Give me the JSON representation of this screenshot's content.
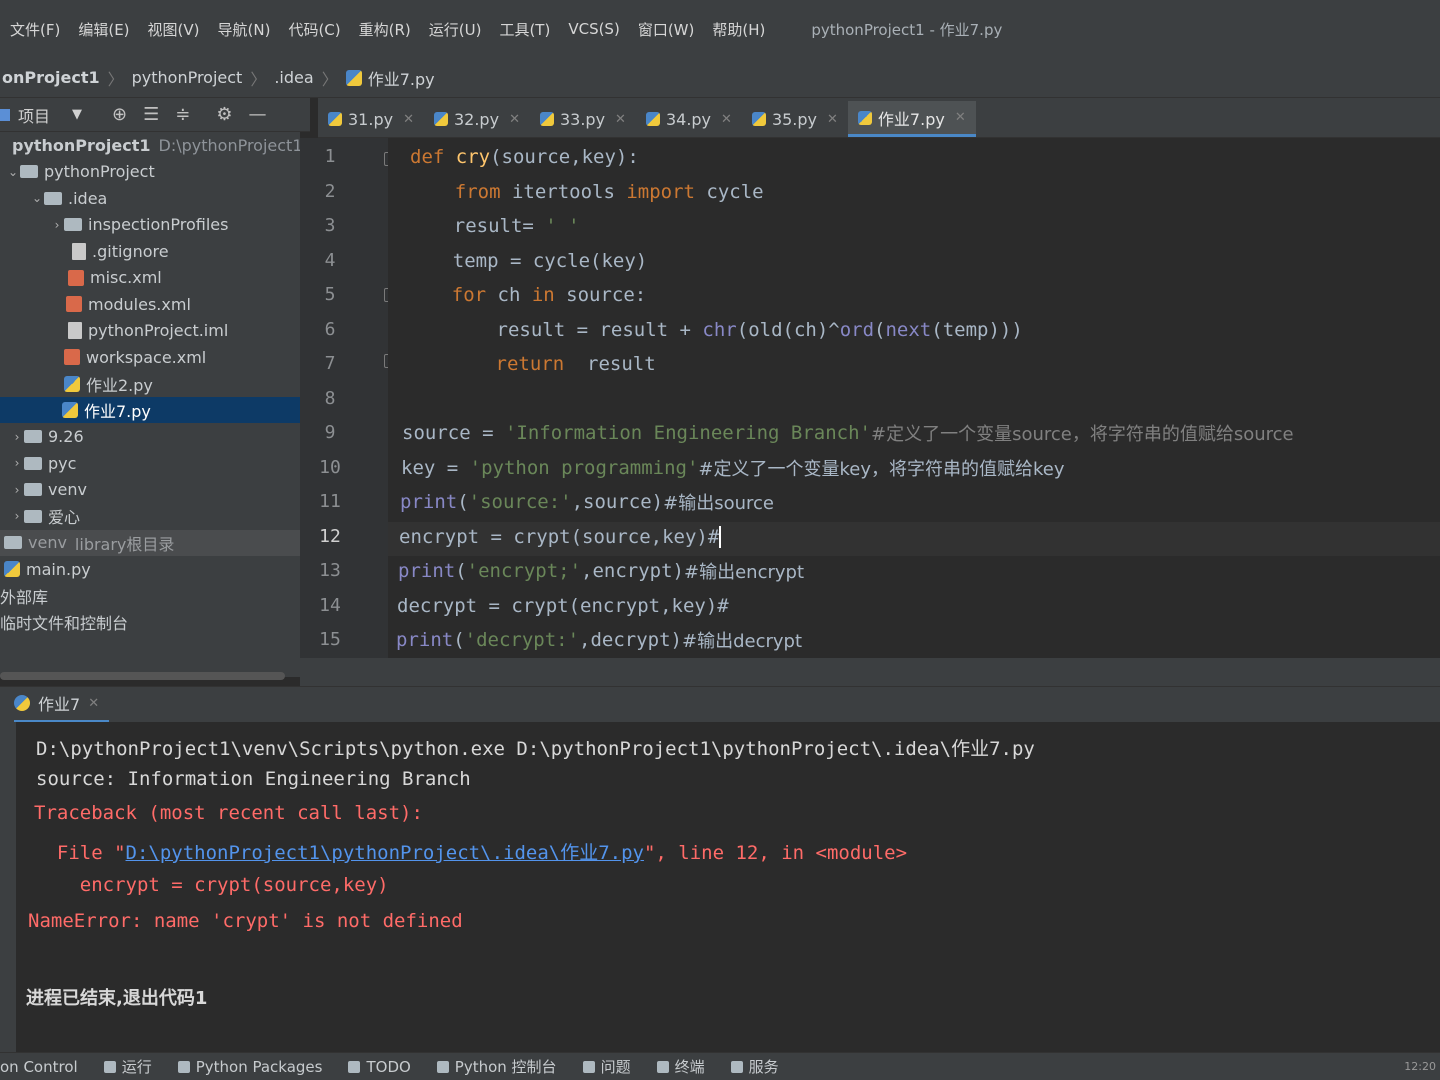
{
  "menu": {
    "items": [
      "文件(F)",
      "编辑(E)",
      "视图(V)",
      "导航(N)",
      "代码(C)",
      "重构(R)",
      "运行(U)",
      "工具(T)",
      "VCS(S)",
      "窗口(W)",
      "帮助(H)"
    ],
    "window_title": "pythonProject1 - 作业7.py"
  },
  "breadcrumb": [
    "onProject1",
    "pythonProject",
    ".idea",
    "作业7.py"
  ],
  "project_panel": {
    "title": "项目",
    "tree": [
      {
        "label": "pythonProject1",
        "path": "D:\\pythonProject1",
        "kind": "folder",
        "expanded": true
      },
      {
        "label": "pythonProject",
        "kind": "folder",
        "expanded": true
      },
      {
        "label": ".idea",
        "kind": "folder",
        "expanded": true
      },
      {
        "label": "inspectionProfiles",
        "kind": "folder",
        "expanded": false
      },
      {
        "label": ".gitignore",
        "kind": "file"
      },
      {
        "label": "misc.xml",
        "kind": "xml"
      },
      {
        "label": "modules.xml",
        "kind": "xml"
      },
      {
        "label": "pythonProject.iml",
        "kind": "file"
      },
      {
        "label": "workspace.xml",
        "kind": "xml"
      },
      {
        "label": "作业2.py",
        "kind": "py"
      },
      {
        "label": "作业7.py",
        "kind": "py",
        "selected": true
      },
      {
        "label": "9.26",
        "kind": "folder",
        "expanded": false
      },
      {
        "label": "pyc",
        "kind": "folder",
        "expanded": false
      },
      {
        "label": "venv",
        "kind": "folder",
        "expanded": false
      },
      {
        "label": "爱心",
        "kind": "folder",
        "expanded": false
      },
      {
        "label": "venv",
        "suffix": "library根目录",
        "kind": "folder",
        "library": true
      },
      {
        "label": "main.py",
        "kind": "py"
      },
      {
        "label": "外部库",
        "kind": "text"
      },
      {
        "label": "临时文件和控制台",
        "kind": "text"
      }
    ]
  },
  "tabs": [
    {
      "label": "31.py",
      "active": false
    },
    {
      "label": "32.py",
      "active": false
    },
    {
      "label": "33.py",
      "active": false
    },
    {
      "label": "34.py",
      "active": false
    },
    {
      "label": "35.py",
      "active": false
    },
    {
      "label": "作业7.py",
      "active": true
    }
  ],
  "editor": {
    "current_line": 12,
    "line_numbers": [
      "1",
      "2",
      "3",
      "4",
      "5",
      "6",
      "7",
      "8",
      "9",
      "10",
      "11",
      "12",
      "13",
      "14",
      "15"
    ],
    "lines": [
      [
        {
          "t": "def ",
          "c": "kw"
        },
        {
          "t": "cry",
          "c": "fn"
        },
        {
          "t": "(source,key):",
          "c": "pl"
        }
      ],
      [
        {
          "t": "    from ",
          "c": "kw"
        },
        {
          "t": "itertools ",
          "c": "pl"
        },
        {
          "t": "import ",
          "c": "kw"
        },
        {
          "t": "cycle",
          "c": "pl"
        }
      ],
      [
        {
          "t": "    result= ",
          "c": "pl"
        },
        {
          "t": "' '",
          "c": "st"
        }
      ],
      [
        {
          "t": "    temp = cycle(key)",
          "c": "pl"
        }
      ],
      [
        {
          "t": "    for ",
          "c": "kw"
        },
        {
          "t": "ch ",
          "c": "pl"
        },
        {
          "t": "in ",
          "c": "kw"
        },
        {
          "t": "source:",
          "c": "pl"
        }
      ],
      [
        {
          "t": "        result = result + ",
          "c": "pl"
        },
        {
          "t": "chr",
          "c": "bi"
        },
        {
          "t": "(old(ch)^",
          "c": "pl"
        },
        {
          "t": "ord",
          "c": "bi"
        },
        {
          "t": "(",
          "c": "pl"
        },
        {
          "t": "next",
          "c": "bi"
        },
        {
          "t": "(temp)))",
          "c": "pl"
        }
      ],
      [
        {
          "t": "        return  ",
          "c": "kw"
        },
        {
          "t": "result",
          "c": "pl"
        }
      ],
      [],
      [
        {
          "t": "source = ",
          "c": "pl"
        },
        {
          "t": "'Information Engineering Branch'",
          "c": "st"
        },
        {
          "t": "#定义了一个变量source，将字符串的值赋给source",
          "c": "cmd"
        }
      ],
      [
        {
          "t": "key = ",
          "c": "pl"
        },
        {
          "t": "'python programming'",
          "c": "st"
        },
        {
          "t": "#定义了一个变量key，将字符串的值赋给key",
          "c": "cm"
        }
      ],
      [
        {
          "t": "print",
          "c": "bi"
        },
        {
          "t": "(",
          "c": "pl"
        },
        {
          "t": "'source:'",
          "c": "st"
        },
        {
          "t": ",source)",
          "c": "pl"
        },
        {
          "t": "#输出source",
          "c": "cm"
        }
      ],
      [
        {
          "t": "encrypt = crypt(source,key)#",
          "c": "pl"
        }
      ],
      [
        {
          "t": "print",
          "c": "bi"
        },
        {
          "t": "(",
          "c": "pl"
        },
        {
          "t": "'encrypt;'",
          "c": "st"
        },
        {
          "t": ",encrypt)",
          "c": "pl"
        },
        {
          "t": "#输出encrypt",
          "c": "cm"
        }
      ],
      [
        {
          "t": "decrypt = crypt(encrypt,key)#",
          "c": "pl"
        }
      ],
      [
        {
          "t": "print",
          "c": "bi"
        },
        {
          "t": "(",
          "c": "pl"
        },
        {
          "t": "'decrypt:'",
          "c": "st"
        },
        {
          "t": ",decrypt)",
          "c": "pl"
        },
        {
          "t": "#输出decrypt",
          "c": "cm"
        }
      ]
    ]
  },
  "run": {
    "tab_label": "作业7",
    "command": "D:\\pythonProject1\\venv\\Scripts\\python.exe D:\\pythonProject1\\pythonProject\\.idea\\作业7.py",
    "output_source": "source: Information Engineering Branch",
    "traceback_header": "Traceback (most recent call last):",
    "file_prefix": "  File \"",
    "file_link": "D:\\pythonProject1\\pythonProject\\.idea\\作业7.py",
    "file_suffix": "\", line 12, in <module>",
    "code_line": "    encrypt = crypt(source,key)",
    "error": "NameError: name 'crypt' is not defined",
    "exit_message": "进程已结束,退出代码1"
  },
  "bottom_toolbar": [
    "on Control",
    "运行",
    "Python Packages",
    "TODO",
    "Python 控制台",
    "问题",
    "终端",
    "服务"
  ],
  "clock": "12:20",
  "colors": {
    "keyword": "#cc7832",
    "string": "#6a8759",
    "error": "#ff6b68",
    "link": "#5394ec",
    "selection": "#0d3a66"
  }
}
